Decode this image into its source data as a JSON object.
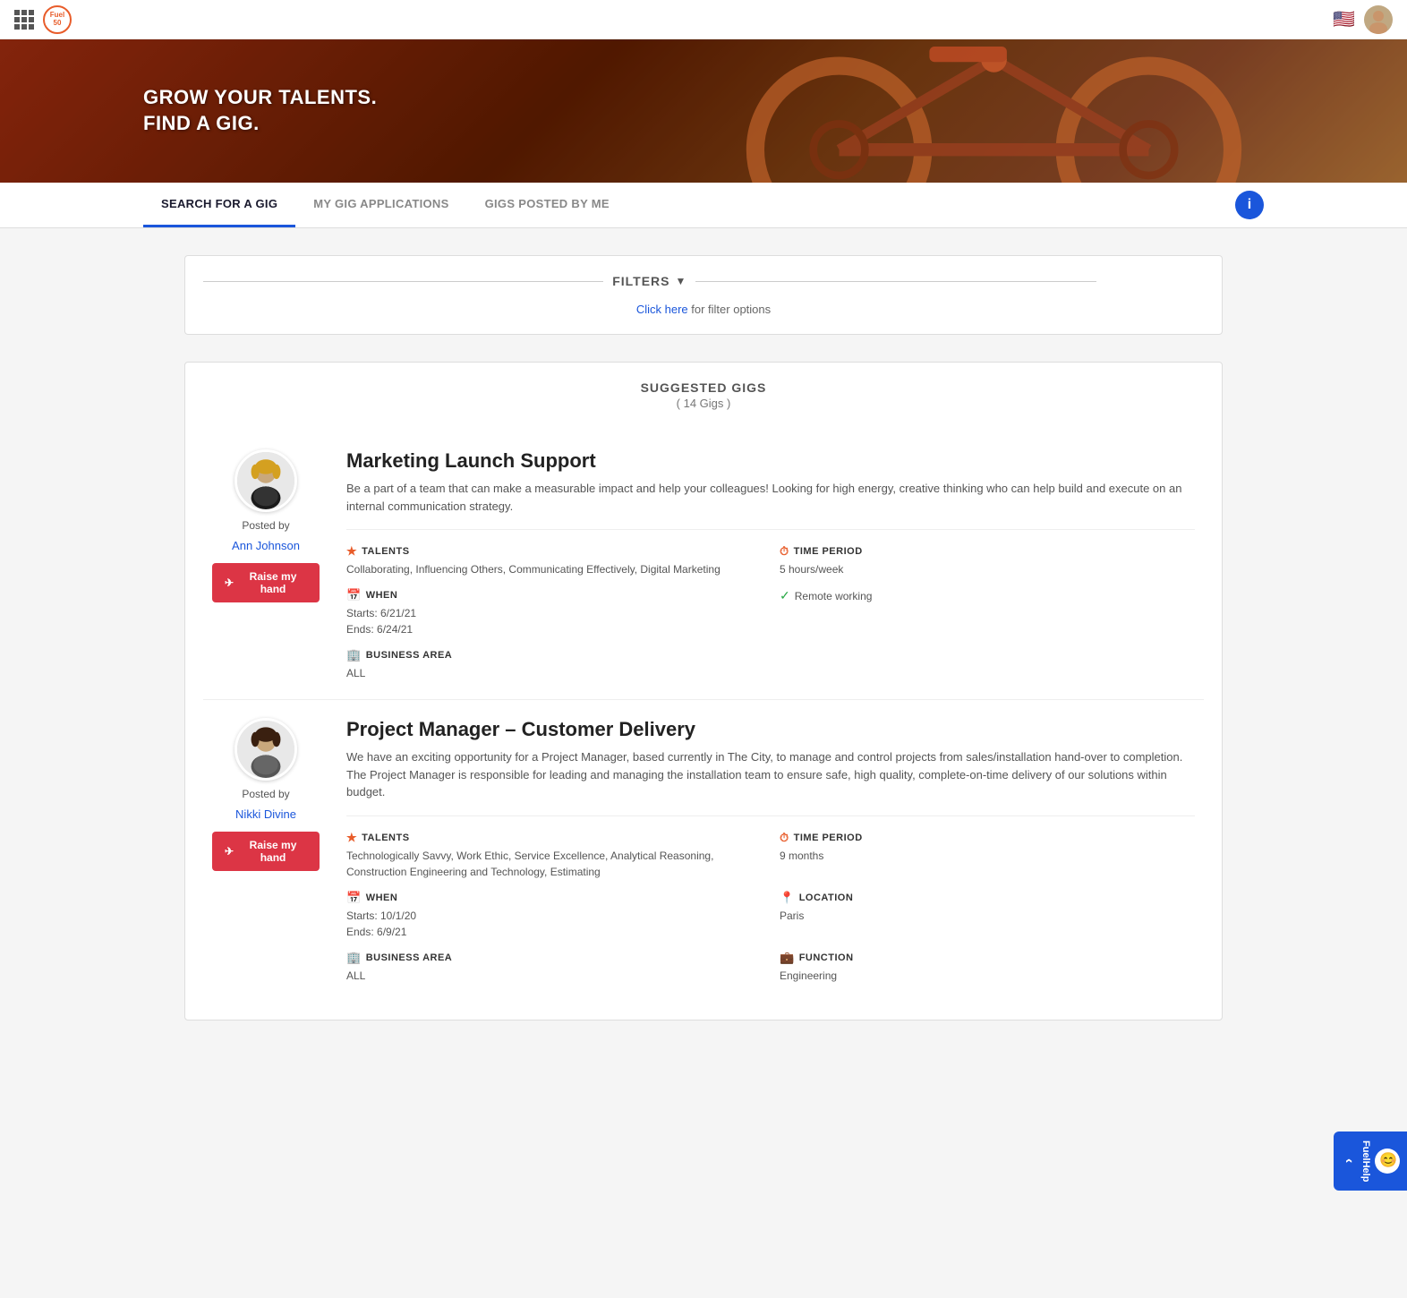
{
  "app": {
    "logo": "Fuel50",
    "logo_text": "Fuel\n50"
  },
  "hero": {
    "line1": "GROW YOUR TALENTS.",
    "line2": "FIND A GIG."
  },
  "tabs": {
    "items": [
      {
        "id": "search",
        "label": "SEARCH FOR A GIG",
        "active": true
      },
      {
        "id": "applications",
        "label": "MY GIG APPLICATIONS",
        "active": false
      },
      {
        "id": "posted",
        "label": "GIGS POSTED BY ME",
        "active": false
      }
    ]
  },
  "filters": {
    "title": "FILTERS",
    "click_text": "for filter options",
    "click_link": "Click here"
  },
  "suggested": {
    "title": "SUGGESTED GIGS",
    "count": "( 14 Gigs )",
    "gigs": [
      {
        "id": "gig1",
        "title": "Marketing Launch Support",
        "description": "Be a part of a team that can make a measurable impact and help your colleagues!   Looking for high energy, creative thinking who can help build and execute on an internal communication strategy.",
        "poster_name": "Ann Johnson",
        "posted_by_label": "Posted by",
        "raise_hand_label": "Raise my hand",
        "details": {
          "talents_label": "TALENTS",
          "talents_value": "Collaborating,  Influencing Others,  Communicating Effectively,  Digital Marketing",
          "time_period_label": "TIME PERIOD",
          "time_period_value": "5 hours/week",
          "when_label": "WHEN",
          "when_starts": "Starts: 6/21/21",
          "when_ends": "Ends: 6/24/21",
          "remote_label": "Remote working",
          "business_area_label": "BUSINESS AREA",
          "business_area_value": "ALL"
        }
      },
      {
        "id": "gig2",
        "title": "Project Manager – Customer Delivery",
        "description": "We have an exciting opportunity for a Project Manager, based currently in The City, to manage and control projects from sales/installation hand-over to completion.  The Project Manager is responsible for leading and managing the installation team to ensure safe, high quality, complete-on-time delivery of our solutions within budget.",
        "poster_name": "Nikki Divine",
        "posted_by_label": "Posted by",
        "raise_hand_label": "Raise my hand",
        "details": {
          "talents_label": "TALENTS",
          "talents_value": "Technologically Savvy,  Work Ethic,  Service Excellence,  Analytical Reasoning,  Construction Engineering and Technology,  Estimating",
          "time_period_label": "TIME PERIOD",
          "time_period_value": "9 months",
          "when_label": "WHEN",
          "when_starts": "Starts: 10/1/20",
          "when_ends": "Ends: 6/9/21",
          "location_label": "LOCATION",
          "location_value": "Paris",
          "business_area_label": "BUSINESS AREA",
          "business_area_value": "ALL",
          "function_label": "FUNCTION",
          "function_value": "Engineering"
        }
      }
    ]
  },
  "help_widget": {
    "label": "FuelHelp"
  }
}
